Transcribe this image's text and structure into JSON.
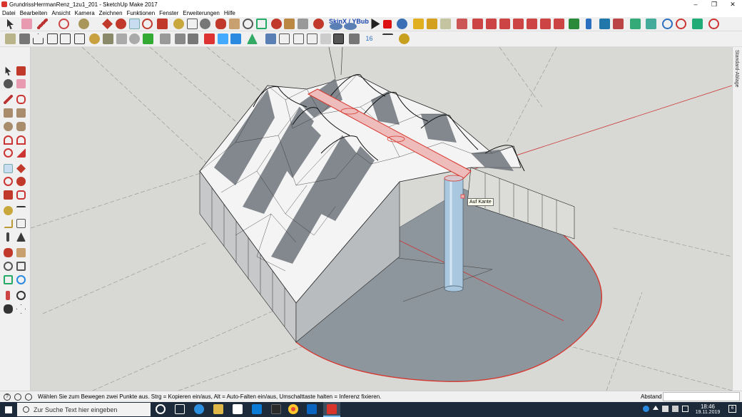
{
  "window": {
    "title": "GrundrissHerrmanRenz_1zu1_201 - SketchUp Make 2017",
    "minimize": "–",
    "restore": "❒",
    "close": "✕"
  },
  "menu": [
    "Datei",
    "Bearbeiten",
    "Ansicht",
    "Kamera",
    "Zeichnen",
    "Funktionen",
    "Fenster",
    "Erweiterungen",
    "Hilfe"
  ],
  "toolbar": {
    "skinx_label": "SkinX / YBub",
    "scene_label": "16"
  },
  "viewport": {
    "tooltip": "Auf Kante",
    "model": "tent structure with conical peaks"
  },
  "tray": {
    "label": "Standard-Ablage"
  },
  "status": {
    "text": "Wählen Sie zum Bewegen zwei Punkte aus. Strg = Kopieren ein/aus, Alt = Auto-Falten ein/aus, Umschalttaste halten = Inferenz fixieren.",
    "measure_label": "Abstand",
    "measure_value": ""
  },
  "taskbar": {
    "search_placeholder": "Zur Suche Text hier eingeben",
    "time": "18:46",
    "date": "19.11.2019",
    "notifications": "6"
  },
  "colors": {
    "accent_red": "#d9342b",
    "viewport_bg": "#d8d8d4",
    "ground": "#8e969d",
    "taskbar": "#1c2a3a"
  }
}
